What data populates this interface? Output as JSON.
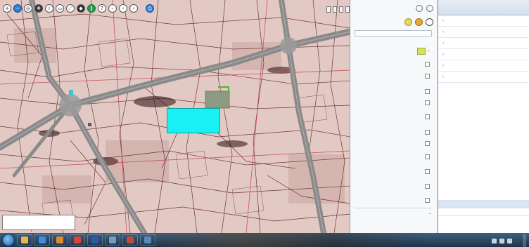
{
  "map": {
    "toolbar_icons": [
      "zoom-in-icon",
      "zoom-out-icon",
      "full-extent-icon",
      "pan-icon",
      "identify-icon",
      "select-icon",
      "measure-icon",
      "measure-area-icon",
      "bookmark-icon",
      "info-icon",
      "minus-icon",
      "back-icon",
      "forward-icon",
      "print-icon"
    ],
    "top_right_controls": [
      "",
      "",
      "",
      "",
      "",
      ""
    ],
    "popup_lines": [
      "",
      "",
      "",
      ""
    ],
    "coord_lines": [
      "",
      ""
    ]
  },
  "layer_panel": {
    "search_placeholder": "",
    "items": [
      "",
      "",
      "",
      "",
      "",
      "",
      "",
      "",
      "",
      "",
      "",
      ""
    ]
  },
  "right_menu": {
    "header": "",
    "items": [
      "",
      "",
      "",
      "",
      "",
      ""
    ],
    "bottom_items": [
      "",
      "",
      ""
    ]
  },
  "taskbar": {
    "apps": [
      {
        "name": "explorer",
        "color": "#e4b84a"
      },
      {
        "name": "ie",
        "color": "#3a8fe0"
      },
      {
        "name": "media",
        "color": "#e08a2e"
      },
      {
        "name": "chrome",
        "color": "#d8463b"
      },
      {
        "name": "word",
        "color": "#2a5aa8"
      },
      {
        "name": "app6",
        "color": "#7a9bb8"
      },
      {
        "name": "app7",
        "color": "#c24a3d"
      },
      {
        "name": "app8",
        "color": "#5f87b5"
      }
    ],
    "clock_time": "",
    "clock_date": ""
  },
  "colors": {
    "popup": "#19f0f3",
    "road": "#8a8a8a",
    "parcel_lines": "#5b1f22",
    "map_bg": "#e3c9c4",
    "highlight_parcel": "#8c9a83"
  }
}
